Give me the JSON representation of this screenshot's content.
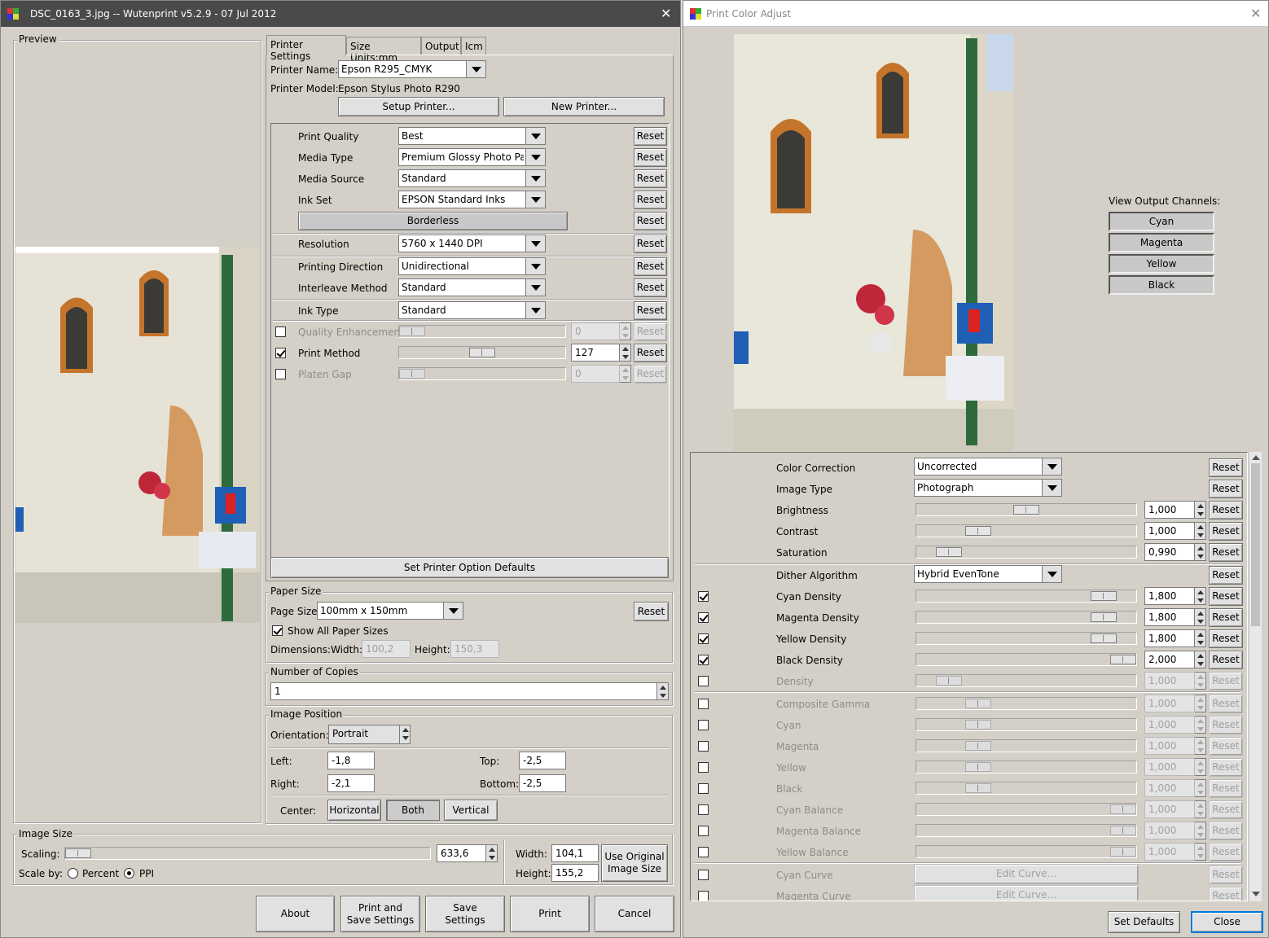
{
  "left_window": {
    "title": "DSC_0163_3.jpg -- Wutenprint v5.2.9 - 07 Jul 2012",
    "preview_label": "Preview",
    "tabs": [
      "Printer Settings",
      "Size Units:mm",
      "Output",
      "Icm"
    ],
    "printer_name_label": "Printer Name:",
    "printer_name": "Epson R295_CMYK",
    "printer_model_label": "Printer Model:",
    "printer_model": "Epson Stylus Photo R290",
    "setup_printer": "Setup Printer...",
    "new_printer": "New Printer...",
    "reset": "Reset",
    "options": [
      {
        "label": "Print Quality",
        "value": "Best"
      },
      {
        "label": "Media Type",
        "value": "Premium Glossy Photo Pap"
      },
      {
        "label": "Media Source",
        "value": "Standard"
      },
      {
        "label": "Ink Set",
        "value": "EPSON Standard Inks"
      }
    ],
    "borderless": "Borderless",
    "options2": [
      {
        "label": "Resolution",
        "value": "5760 x 1440 DPI"
      },
      {
        "label": "Printing Direction",
        "value": "Unidirectional"
      },
      {
        "label": "Interleave Method",
        "value": "Standard"
      },
      {
        "label": "Ink Type",
        "value": "Standard"
      }
    ],
    "sliders": [
      {
        "label": "Quality Enhancement",
        "value": "0",
        "checked": false,
        "enabled": false,
        "level": 0.0
      },
      {
        "label": "Print Method",
        "value": "127",
        "checked": true,
        "enabled": true,
        "level": 0.5
      },
      {
        "label": "Platen Gap",
        "value": "0",
        "checked": false,
        "enabled": false,
        "level": 0.0
      }
    ],
    "set_defaults": "Set Printer Option Defaults",
    "paper_size_group": "Paper Size",
    "page_size_label": "Page Size",
    "page_size": "100mm x 150mm",
    "show_all_sizes": "Show All Paper Sizes",
    "dimensions_label": "Dimensions:Width:",
    "dim_width": "100,2",
    "height_label": "Height:",
    "dim_height": "150,3",
    "copies_group": "Number of Copies",
    "copies": "1",
    "position_group": "Image Position",
    "orientation_label": "Orientation:",
    "orientation": "Portrait",
    "left_label": "Left:",
    "left": "-1,8",
    "top_label": "Top:",
    "top": "-2,5",
    "right_label": "Right:",
    "right": "-2,1",
    "bottom_label": "Bottom:",
    "bottom": "-2,5",
    "center_label": "Center:",
    "center_horizontal": "Horizontal",
    "center_both": "Both",
    "center_vertical": "Vertical",
    "image_size_group": "Image Size",
    "scaling_label": "Scaling:",
    "scaling": "633,6",
    "scale_by_label": "Scale by:",
    "percent": "Percent",
    "ppi": "PPI",
    "width_label": "Width:",
    "width": "104,1",
    "height2_label": "Height:",
    "height": "155,2",
    "use_original": "Use Original\nImage Size",
    "about": "About",
    "print_and_save": "Print and\nSave Settings",
    "save_settings": "Save\nSettings",
    "print": "Print",
    "cancel": "Cancel"
  },
  "right_window": {
    "title": "Print Color Adjust",
    "view_channels_label": "View Output Channels:",
    "channels": [
      "Cyan",
      "Magenta",
      "Yellow",
      "Black"
    ],
    "reset": "Reset",
    "color_correction_label": "Color Correction",
    "color_correction": "Uncorrected",
    "image_type_label": "Image Type",
    "image_type": "Photograph",
    "adjust": [
      {
        "label": "Brightness",
        "value": "1,000",
        "level": 0.5
      },
      {
        "label": "Contrast",
        "value": "1,000",
        "level": 0.25
      },
      {
        "label": "Saturation",
        "value": "0,990",
        "level": 0.1
      }
    ],
    "dither_label": "Dither Algorithm",
    "dither": "Hybrid EvenTone",
    "densities": [
      {
        "label": "Cyan Density",
        "value": "1,800",
        "checked": true,
        "enabled": true,
        "level": 0.9
      },
      {
        "label": "Magenta Density",
        "value": "1,800",
        "checked": true,
        "enabled": true,
        "level": 0.9
      },
      {
        "label": "Yellow Density",
        "value": "1,800",
        "checked": true,
        "enabled": true,
        "level": 0.9
      },
      {
        "label": "Black Density",
        "value": "2,000",
        "checked": true,
        "enabled": true,
        "level": 1.0
      },
      {
        "label": "Density",
        "value": "1,000",
        "checked": false,
        "enabled": false,
        "level": 0.1
      }
    ],
    "gammas": [
      {
        "label": "Composite Gamma",
        "value": "1,000",
        "level": 0.25
      },
      {
        "label": "Cyan",
        "value": "1,000",
        "level": 0.25
      },
      {
        "label": "Magenta",
        "value": "1,000",
        "level": 0.25
      },
      {
        "label": "Yellow",
        "value": "1,000",
        "level": 0.25
      },
      {
        "label": "Black",
        "value": "1,000",
        "level": 0.25
      },
      {
        "label": "Cyan Balance",
        "value": "1,000",
        "level": 1.0
      },
      {
        "label": "Magenta Balance",
        "value": "1,000",
        "level": 1.0
      },
      {
        "label": "Yellow Balance",
        "value": "1,000",
        "level": 1.0
      }
    ],
    "curves": [
      {
        "label": "Cyan Curve",
        "button": "Edit Curve..."
      },
      {
        "label": "Magenta Curve",
        "button": "Edit Curve..."
      }
    ],
    "set_defaults": "Set Defaults",
    "close": "Close"
  }
}
